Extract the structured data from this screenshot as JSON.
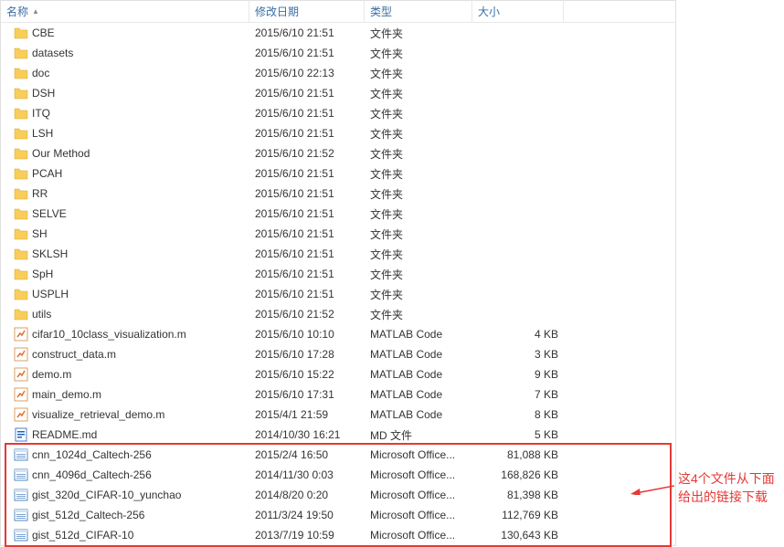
{
  "header": {
    "name": "名称",
    "modified": "修改日期",
    "type": "类型",
    "size": "大小"
  },
  "rows": [
    {
      "icon": "folder",
      "name": "CBE",
      "date": "2015/6/10 21:51",
      "type": "文件夹",
      "size": ""
    },
    {
      "icon": "folder",
      "name": "datasets",
      "date": "2015/6/10 21:51",
      "type": "文件夹",
      "size": ""
    },
    {
      "icon": "folder",
      "name": "doc",
      "date": "2015/6/10 22:13",
      "type": "文件夹",
      "size": ""
    },
    {
      "icon": "folder",
      "name": "DSH",
      "date": "2015/6/10 21:51",
      "type": "文件夹",
      "size": ""
    },
    {
      "icon": "folder",
      "name": "ITQ",
      "date": "2015/6/10 21:51",
      "type": "文件夹",
      "size": ""
    },
    {
      "icon": "folder",
      "name": "LSH",
      "date": "2015/6/10 21:51",
      "type": "文件夹",
      "size": ""
    },
    {
      "icon": "folder",
      "name": "Our Method",
      "date": "2015/6/10 21:52",
      "type": "文件夹",
      "size": ""
    },
    {
      "icon": "folder",
      "name": "PCAH",
      "date": "2015/6/10 21:51",
      "type": "文件夹",
      "size": ""
    },
    {
      "icon": "folder",
      "name": "RR",
      "date": "2015/6/10 21:51",
      "type": "文件夹",
      "size": ""
    },
    {
      "icon": "folder",
      "name": "SELVE",
      "date": "2015/6/10 21:51",
      "type": "文件夹",
      "size": ""
    },
    {
      "icon": "folder",
      "name": "SH",
      "date": "2015/6/10 21:51",
      "type": "文件夹",
      "size": ""
    },
    {
      "icon": "folder",
      "name": "SKLSH",
      "date": "2015/6/10 21:51",
      "type": "文件夹",
      "size": ""
    },
    {
      "icon": "folder",
      "name": "SpH",
      "date": "2015/6/10 21:51",
      "type": "文件夹",
      "size": ""
    },
    {
      "icon": "folder",
      "name": "USPLH",
      "date": "2015/6/10 21:51",
      "type": "文件夹",
      "size": ""
    },
    {
      "icon": "folder",
      "name": "utils",
      "date": "2015/6/10 21:52",
      "type": "文件夹",
      "size": ""
    },
    {
      "icon": "matlab",
      "name": "cifar10_10class_visualization.m",
      "date": "2015/6/10 10:10",
      "type": "MATLAB Code",
      "size": "4 KB"
    },
    {
      "icon": "matlab",
      "name": "construct_data.m",
      "date": "2015/6/10 17:28",
      "type": "MATLAB Code",
      "size": "3 KB"
    },
    {
      "icon": "matlab",
      "name": "demo.m",
      "date": "2015/6/10 15:22",
      "type": "MATLAB Code",
      "size": "9 KB"
    },
    {
      "icon": "matlab",
      "name": "main_demo.m",
      "date": "2015/6/10 17:31",
      "type": "MATLAB Code",
      "size": "7 KB"
    },
    {
      "icon": "matlab",
      "name": "visualize_retrieval_demo.m",
      "date": "2015/4/1 21:59",
      "type": "MATLAB Code",
      "size": "8 KB"
    },
    {
      "icon": "md",
      "name": "README.md",
      "date": "2014/10/30 16:21",
      "type": "MD 文件",
      "size": "5 KB"
    },
    {
      "icon": "office",
      "name": "cnn_1024d_Caltech-256",
      "date": "2015/2/4 16:50",
      "type": "Microsoft Office...",
      "size": "81,088 KB"
    },
    {
      "icon": "office",
      "name": "cnn_4096d_Caltech-256",
      "date": "2014/11/30 0:03",
      "type": "Microsoft Office...",
      "size": "168,826 KB"
    },
    {
      "icon": "office",
      "name": "gist_320d_CIFAR-10_yunchao",
      "date": "2014/8/20 0:20",
      "type": "Microsoft Office...",
      "size": "81,398 KB"
    },
    {
      "icon": "office",
      "name": "gist_512d_Caltech-256",
      "date": "2011/3/24 19:50",
      "type": "Microsoft Office...",
      "size": "112,769 KB"
    },
    {
      "icon": "office",
      "name": "gist_512d_CIFAR-10",
      "date": "2013/7/19 10:59",
      "type": "Microsoft Office...",
      "size": "130,643 KB"
    }
  ],
  "annotation": {
    "line1": "这4个文件从下面",
    "line2": "给出的链接下载"
  }
}
